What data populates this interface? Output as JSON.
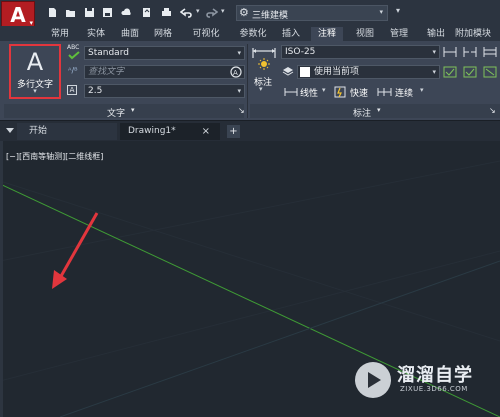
{
  "quick_access": {
    "app_button": "A",
    "workspace": "三维建模"
  },
  "ribbon_tabs": [
    "常用",
    "实体",
    "曲面",
    "网格",
    "可视化",
    "参数化",
    "插入",
    "注释",
    "视图",
    "管理",
    "输出",
    "附加模块"
  ],
  "ribbon_active_tab": "注释",
  "text_panel": {
    "mtext_label": "多行文字",
    "abc_label": "ABC",
    "text_style": "Standard",
    "find_placeholder": "查找文字",
    "text_height": "2.5",
    "title": "文字"
  },
  "dim_panel": {
    "dim_label": "标注",
    "dim_style": "ISO-25",
    "layer": "使用当前项",
    "linear": "线性",
    "quick": "快速",
    "continue": "连续",
    "title": "标注"
  },
  "file_tabs": {
    "start": "开始",
    "drawing": "Drawing1*",
    "close": "×",
    "new": "+"
  },
  "viewport": {
    "label": "[−][西南等轴测][二维线框]"
  },
  "watermark": {
    "text": "溜溜自学",
    "url": "ZIXUE.3D66.COM"
  },
  "colors": {
    "highlight": "#e2363d",
    "axis_y": "#3f9b35",
    "axis_x": "#2a3a44"
  }
}
